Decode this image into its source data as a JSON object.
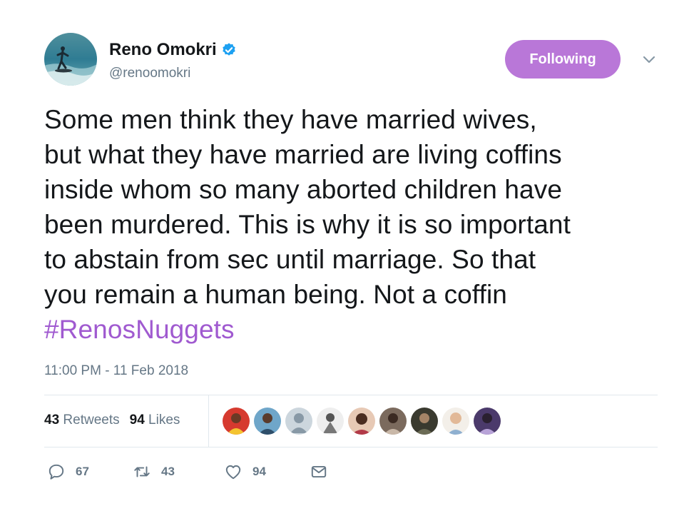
{
  "user": {
    "name": "Reno Omokri",
    "handle": "@renoomokri",
    "follow_label": "Following"
  },
  "tweet": {
    "lines": [
      "Some men think they have married wives,",
      "but what they have married are living coffins",
      "inside whom so many aborted children have",
      "been murdered. This is why it is so important",
      "to abstain from sec until marriage. So that",
      "you remain a human being. Not a coffin"
    ],
    "hashtag": "#RenosNuggets",
    "timestamp": "11:00 PM - 11 Feb 2018"
  },
  "stats": {
    "retweets_count": "43",
    "retweets_label": "Retweets",
    "likes_count": "94",
    "likes_label": "Likes"
  },
  "actions": {
    "reply_count": "67",
    "retweet_count": "43",
    "like_count": "94"
  },
  "colors": {
    "accent": "#b977d8",
    "hashtag": "#a05ad0",
    "verified": "#1da1f2",
    "muted": "#657786"
  },
  "icons": [
    "verified-badge-icon",
    "chevron-down-icon",
    "reply-icon",
    "retweet-icon",
    "heart-icon",
    "direct-message-icon"
  ]
}
